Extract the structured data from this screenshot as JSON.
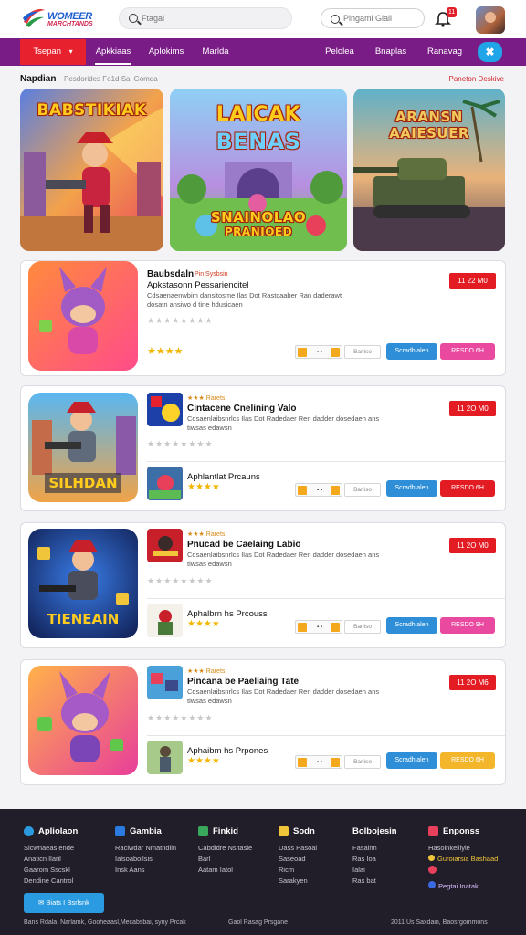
{
  "header": {
    "logo_text": "WOMEER",
    "logo_sub": "MARCHTANDS",
    "search_placeholder": "Ftagai",
    "search2_placeholder": "Pingaml Giali",
    "bell_badge": "11"
  },
  "nav": {
    "items": [
      "Tsepan",
      "Apkkiaas",
      "Aplokims",
      "Marlda",
      "Pelolea",
      "Bnaplas",
      "Ranavag"
    ],
    "active_suffix": "▾",
    "close_label": "✖"
  },
  "section": {
    "title": "Napdian",
    "subtitle": "Pesdorides  Fo1d  Sal Gomda",
    "link": "Paneton  Deskive"
  },
  "banners": [
    {
      "title": "BABSTIKIAK"
    },
    {
      "title": "LAICAK",
      "title2": "BENAS",
      "title3": "SNAINOLAO",
      "title4": "PRANIOED"
    },
    {
      "title": "ARANSN",
      "title2": "AAIESUER"
    }
  ],
  "cards": [
    {
      "title": "Baubsdaln",
      "meta": "Pin Sysbsin",
      "subtitle": "Apkstasonn Pessariencitel",
      "desc": "Cdsaenaenwbim dansitosme Ilas Dot Rastcaaber Ran daderawt dosatn ansiwo d tine hdusicaen",
      "price": "11 22 M0",
      "buttons": [
        "Barliso",
        "Scradhialen",
        "RESDO 6H"
      ],
      "btn_colors": [
        "#2e8fd8",
        "#e94aa0"
      ]
    },
    {
      "meta": "Rarets",
      "title": "Cintacene Cnelining Valo",
      "desc": "Cdsaenlaibsnrlcs Ilas Dot Radedaer Ren dadder dosedaen ans tiwsas edawsn",
      "price": "11 2O M0",
      "sub_title": "Aphlantlat Prcauns",
      "buttons": [
        "Barliso",
        "Scradhialen",
        "RESDO 6H"
      ],
      "btn_colors": [
        "#2e8fd8",
        "#e31b23"
      ]
    },
    {
      "meta": "Rarets",
      "title": "Pnucad be Caelaing Labio",
      "desc": "Cdsaenlaibsnrlcs Ilas Dot Radedaer Ren dadder dosedaen ans tiwsas edawsn",
      "price": "11 2O M0",
      "sub_title": "Aphalbrn hs Prcouss",
      "buttons": [
        "Barliso",
        "Scradhialen",
        "RESDO 9H"
      ],
      "btn_colors": [
        "#2e8fd8",
        "#e94aa0"
      ]
    },
    {
      "meta": "Rarets",
      "title": "Pincana be Paeliaing Tate",
      "desc": "Cdsaenlaibsnrlcs Ilas Dot Radedaer Ren dadder dosedaen ans tiwsas edawsn",
      "price": "11 2O M6",
      "sub_title": "Aphaibm hs Prpones",
      "buttons": [
        "Barliso",
        "Scradhialen",
        "RESDO 6H"
      ],
      "btn_colors": [
        "#2e8fd8",
        "#f3b52a"
      ]
    }
  ],
  "footer": {
    "cols": [
      {
        "head": "Apliolaon",
        "links": [
          "Sicwnaeas ende",
          "Anaticn Ilaril",
          "Gaarom Sscskl",
          "Dendine Cantrol"
        ]
      },
      {
        "head": "Gambia",
        "links": [
          "Raciwdar Nmatndiin",
          "Ialsoaboilsis",
          "Insk Aans"
        ]
      },
      {
        "head": "Finkid",
        "links": [
          "Cabdidre Nsitasle",
          "Barl",
          "Aatam Iatol"
        ]
      },
      {
        "head": "Sodn",
        "links": [
          "Dass Pasoai",
          "Saseoad",
          "Ricm",
          "Sarakyen"
        ]
      },
      {
        "head": "Bolbojesin",
        "links": [
          "Fasainn",
          "Ras Ioa",
          "Ialai",
          "Ras bat"
        ]
      },
      {
        "head": "Enponss",
        "links": [
          "Hasoinkelliyie",
          "Guroiarsia Bashaad",
          "",
          "Pegtai Inatak"
        ]
      }
    ],
    "button": "Biats I Bsrlsnk",
    "bottom_left": "Bans Rdala, Narlamk, Gooheaasl,Mecabsbai, syny Prcak",
    "bottom_mid": "Gaol Rasag Prsgane",
    "bottom_right": "2011 Us Saxdain, Baosrgommons"
  },
  "colors": {
    "nav_bg": "#7a1c86",
    "nav_active": "#e8212f",
    "price": "#e31b23",
    "footer_bg": "#211e2a"
  }
}
